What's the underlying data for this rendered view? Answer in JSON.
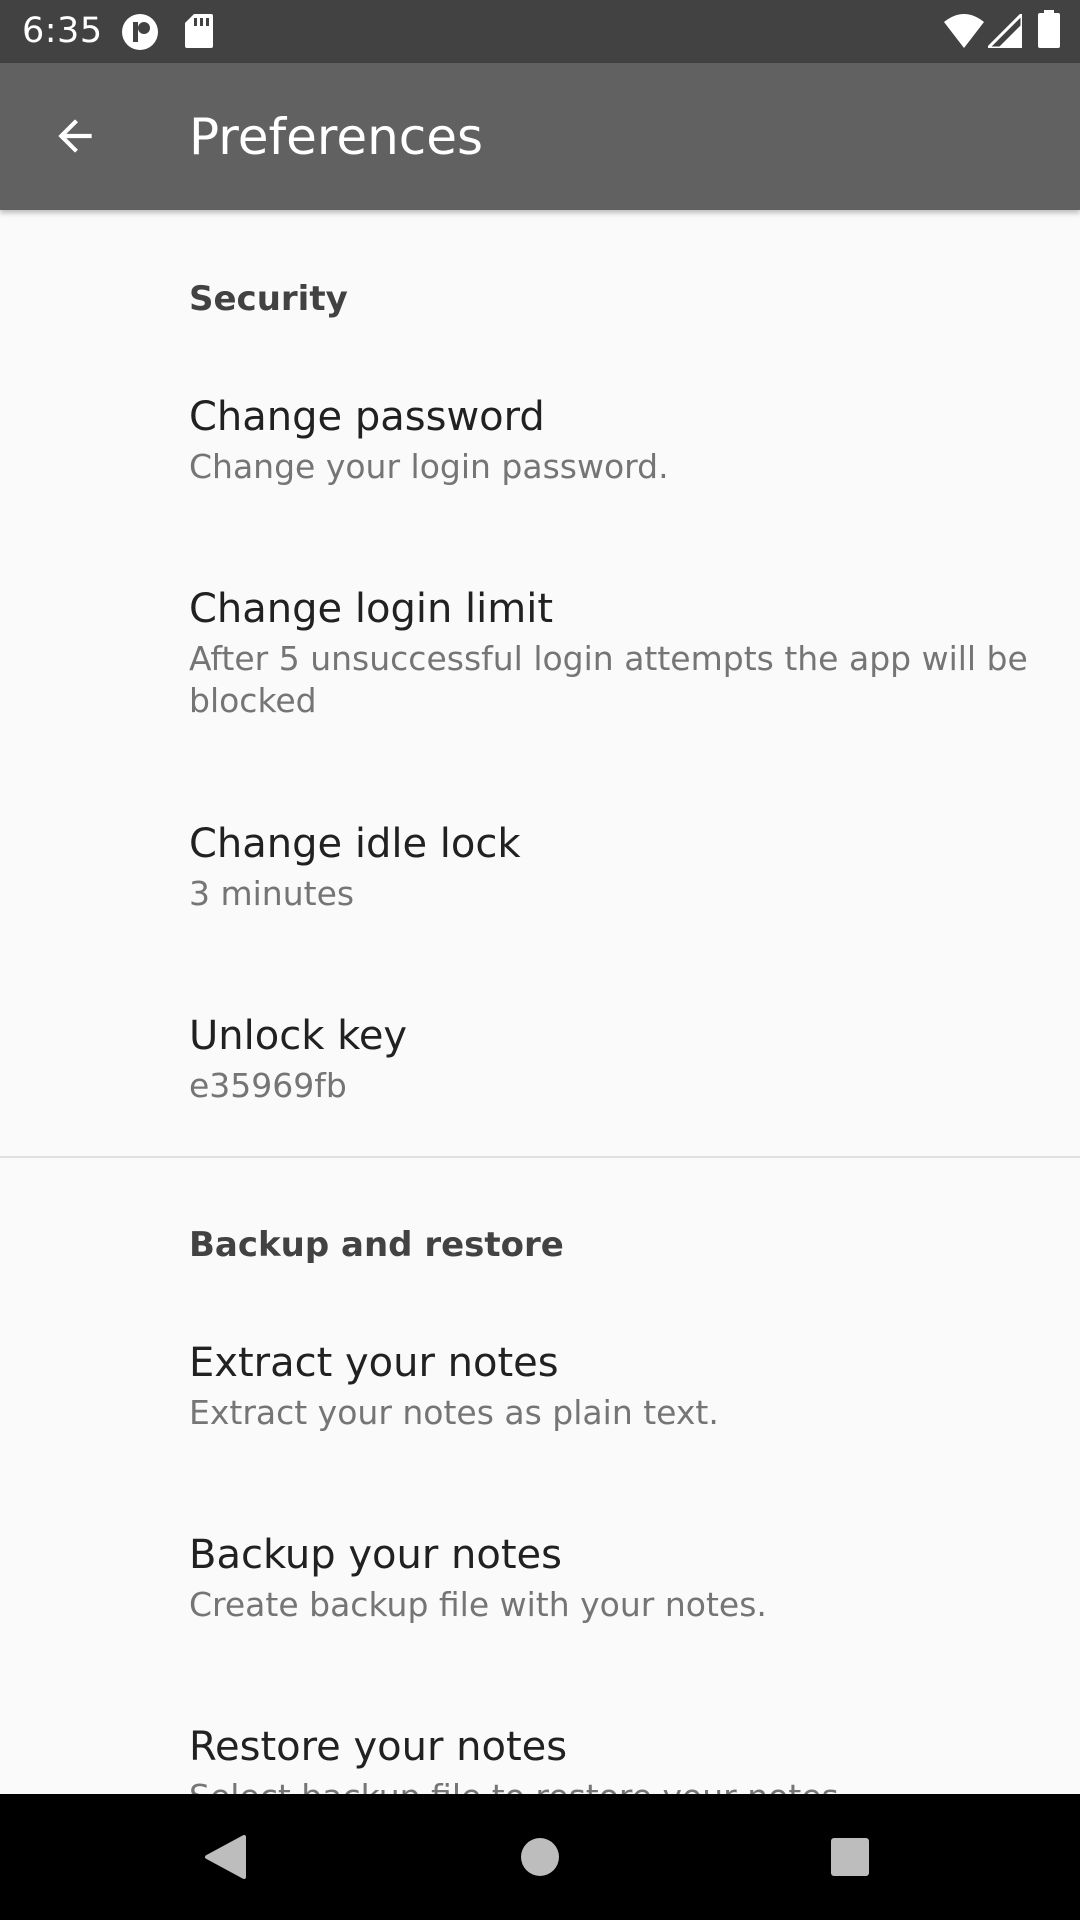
{
  "status_bar": {
    "time": "6:35",
    "left_icons": [
      "notification-app-icon",
      "sd-card-icon"
    ],
    "right_icons": [
      "wifi-icon",
      "signal-icon",
      "battery-icon"
    ]
  },
  "app_bar": {
    "title": "Preferences",
    "back_icon": "arrow-back-icon"
  },
  "sections": [
    {
      "header": "Security",
      "items": [
        {
          "title": "Change password",
          "summary": "Change your login password."
        },
        {
          "title": "Change login limit",
          "summary": "After 5 unsuccessful login attempts the app will be blocked"
        },
        {
          "title": "Change idle lock",
          "summary": "3 minutes"
        },
        {
          "title": "Unlock key",
          "summary": "e35969fb"
        }
      ]
    },
    {
      "header": "Backup and restore",
      "items": [
        {
          "title": "Extract your notes",
          "summary": "Extract your notes as plain text."
        },
        {
          "title": "Backup your notes",
          "summary": "Create backup file with your notes."
        },
        {
          "title": "Restore your notes",
          "summary": "Select backup file to restore your notes"
        }
      ]
    }
  ],
  "nav_bar": {
    "buttons": [
      "back-triangle-icon",
      "home-circle-icon",
      "recents-square-icon"
    ]
  },
  "colors": {
    "status_bar": "#424242",
    "app_bar": "#616161",
    "background": "#fafafa",
    "title_text": "#212121",
    "summary_text": "#757575",
    "category_text": "#424242",
    "nav_bar": "#000000"
  }
}
